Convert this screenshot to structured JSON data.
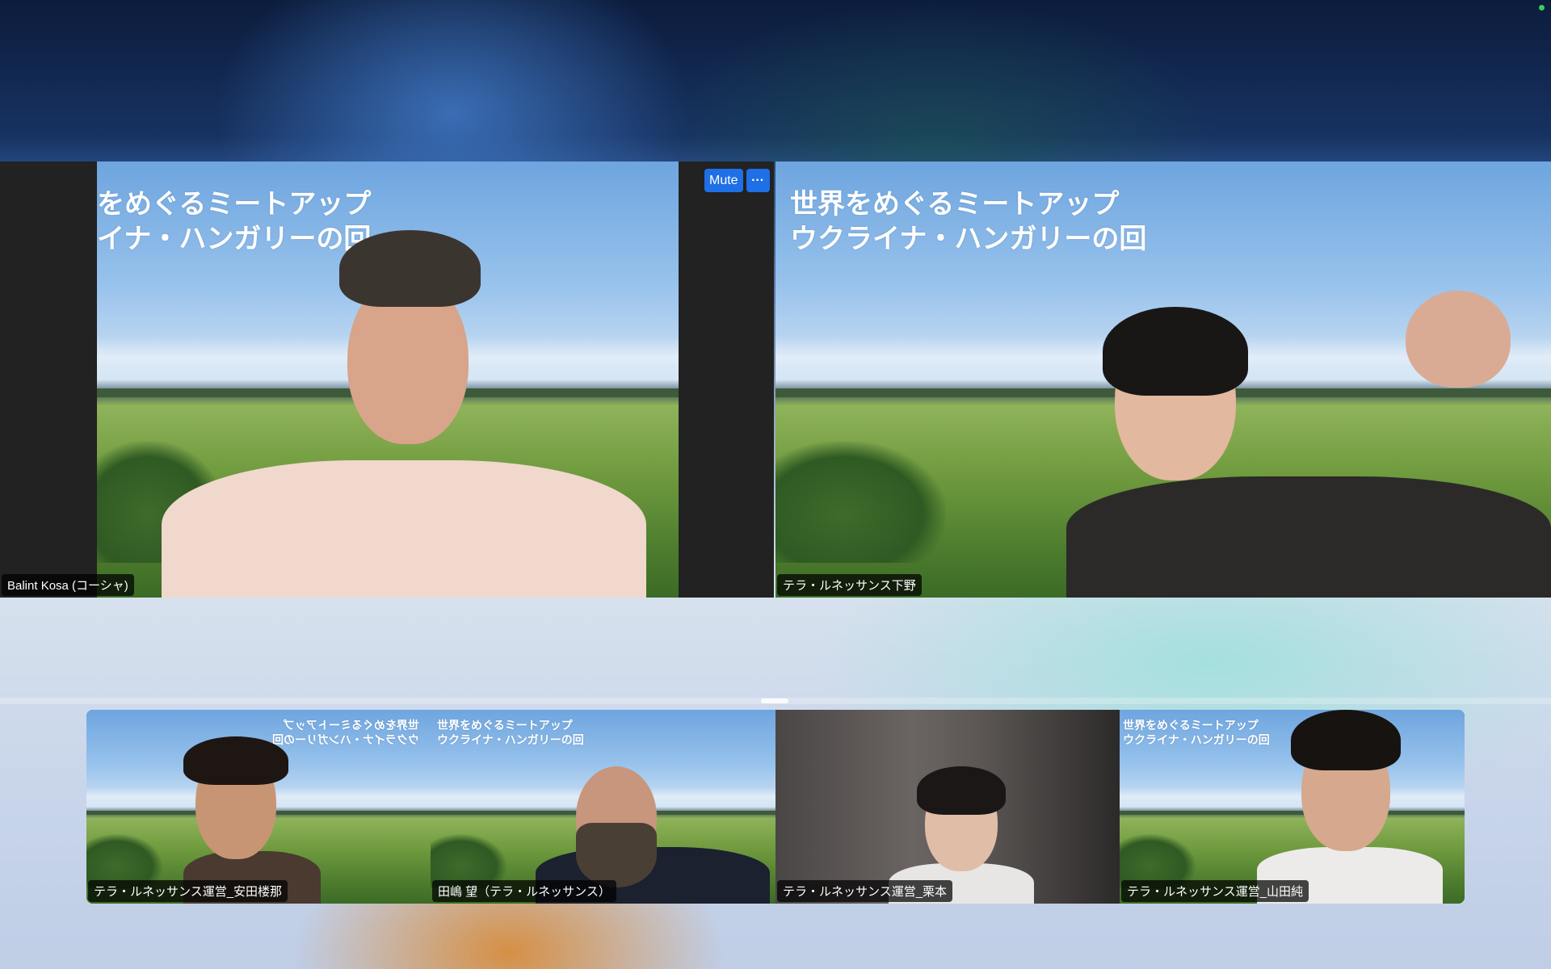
{
  "window": {
    "status_color": "#33d15a"
  },
  "banner": {
    "line1": "世界をめぐるミートアップ",
    "line2": "ウクライナ・ハンガリーの回",
    "line1_cropped": "をめぐるミートアップ",
    "line2_cropped": "イナ・ハンガリーの回",
    "line1_mirrored": "世界をめぐるミートアップ",
    "line2_mirrored": "ウクライナ・ハンガリーの回",
    "line1_small_crop": "世界をめぐるミートアップ",
    "line2_small_crop": "ウクライナ・ハンガリーの回"
  },
  "controls": {
    "mute_label": "Mute",
    "more_label": "···",
    "accent": "#1f6fe6"
  },
  "participants": [
    {
      "name": "Balint Kosa (コーシャ)"
    },
    {
      "name": "テラ・ルネッサンス下野"
    },
    {
      "name": "テラ・ルネッサンス運営_安田楼那"
    },
    {
      "name": "田嶋 望（テラ・ルネッサンス）"
    },
    {
      "name": "テラ・ルネッサンス運営_栗本"
    },
    {
      "name": "テラ・ルネッサンス運営_山田純"
    }
  ]
}
